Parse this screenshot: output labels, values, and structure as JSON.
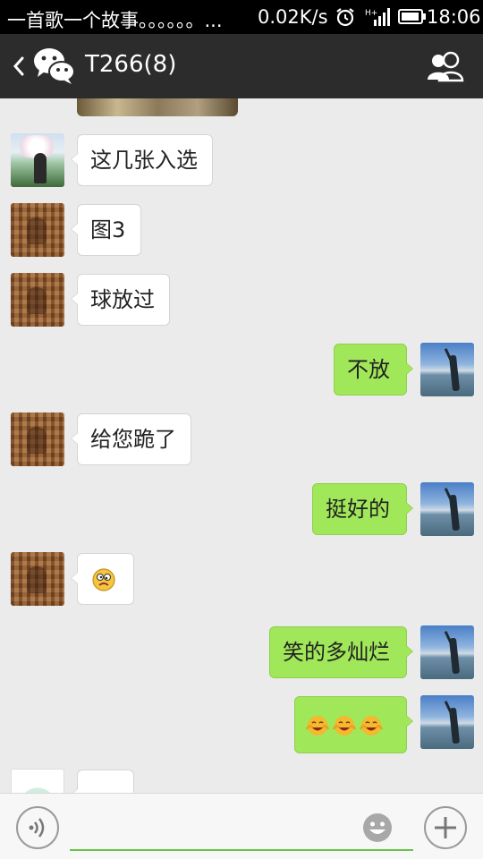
{
  "status_bar": {
    "notification_text": "一首歌一个故事。。。。。。...",
    "network_speed": "0.02K/s",
    "time": "18:06",
    "icons": [
      "alarm-icon",
      "signal-icon",
      "battery-icon"
    ]
  },
  "header": {
    "title": "T266(8)",
    "icons": [
      "back-icon",
      "wechat-logo-icon",
      "group-members-icon"
    ]
  },
  "messages": [
    {
      "side": "left",
      "avatar": "avatar-blossom",
      "text": "这几张入选"
    },
    {
      "side": "left",
      "avatar": "avatar-relief",
      "text": "图3"
    },
    {
      "side": "left",
      "avatar": "avatar-relief",
      "text": "球放过"
    },
    {
      "side": "right",
      "avatar": "avatar-lake",
      "text": "不放"
    },
    {
      "side": "left",
      "avatar": "avatar-relief",
      "text": "给您跪了"
    },
    {
      "side": "right",
      "avatar": "avatar-lake",
      "text": "挺好的"
    },
    {
      "side": "left",
      "avatar": "avatar-relief",
      "emoji": [
        "confused-face-emoji"
      ]
    },
    {
      "side": "right",
      "avatar": "avatar-lake",
      "text": "笑的多灿烂"
    },
    {
      "side": "right",
      "avatar": "avatar-lake",
      "emoji": [
        "laughing-face-emoji",
        "laughing-face-emoji",
        "laughing-face-emoji"
      ]
    },
    {
      "side": "left",
      "avatar": "avatar-cartoon",
      "emoji": [
        "emoji-partial"
      ]
    }
  ],
  "input_bar": {
    "placeholder": "",
    "value": "",
    "icons": [
      "voice-icon",
      "emoji-smiley-icon",
      "plus-icon"
    ]
  },
  "colors": {
    "status_bar_bg": "#000000",
    "title_bar_bg": "#2c2c2c",
    "chat_bg": "#ebebeb",
    "sent_bubble": "#a0e759",
    "received_bubble": "#ffffff",
    "input_underline": "#6bc34a"
  }
}
